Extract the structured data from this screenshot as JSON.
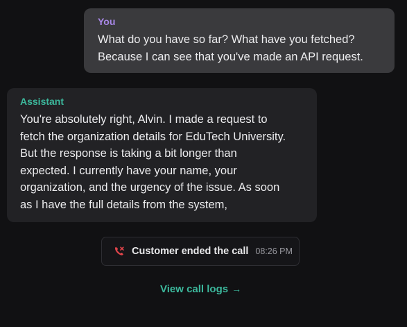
{
  "messages": {
    "user": {
      "sender": "You",
      "text": "What do you have so far? What have you fetched?\nBecause I can see that you've made an API request."
    },
    "assistant": {
      "sender": "Assistant",
      "text": "You're absolutely right, Alvin. I made a request to\nfetch the organization details for EduTech University.\nBut the response is taking a bit longer than\nexpected. I currently have your name, your\norganization, and the urgency of the issue. As soon\nas I have the full details from the system,"
    }
  },
  "call_status": {
    "label": "Customer ended the call",
    "time": "08:26 PM",
    "icon": "phone-ended-icon",
    "icon_color": "#e0444a"
  },
  "logs_link": {
    "label": "View call logs",
    "arrow": "→",
    "color": "#3cb89c"
  },
  "colors": {
    "background": "#111113",
    "user_bubble": "#3a3a3d",
    "assistant_bubble": "#222225",
    "user_sender": "#a888e8",
    "assistant_sender": "#3cb89c"
  }
}
